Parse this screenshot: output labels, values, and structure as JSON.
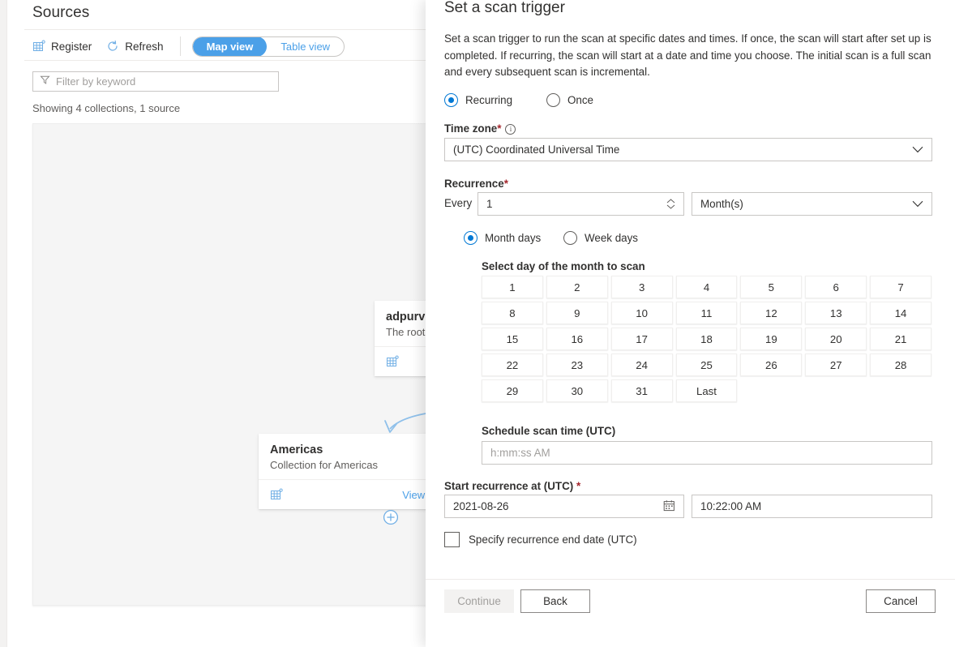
{
  "background": {
    "page_title": "Sources",
    "toolbar": {
      "register_label": "Register",
      "register_icon": "register-grid-icon",
      "refresh_label": "Refresh",
      "refresh_icon": "refresh-icon",
      "views": [
        {
          "label": "Map view",
          "active": true
        },
        {
          "label": "Table view",
          "active": false
        }
      ]
    },
    "filter": {
      "placeholder": "Filter by keyword",
      "value": "",
      "icon": "filter-funnel-icon"
    },
    "status_text": "Showing 4 collections, 1 source",
    "cards": [
      {
        "name": "adpurvi",
        "description": "The root c",
        "footer_icon": "register-grid-icon",
        "link": ""
      },
      {
        "name": "Americas",
        "description": "Collection for Americas",
        "footer_icon": "register-grid-icon",
        "link": "View d"
      }
    ],
    "add_node_icon": "plus-circle-icon"
  },
  "panel": {
    "title": "Set a scan trigger",
    "description": "Set a scan trigger to run the scan at specific dates and times. If once, the scan will start after set up is completed. If recurring, the scan will start at a date and time you choose. The initial scan is a full scan and every subsequent scan is incremental.",
    "trigger_mode": {
      "options": [
        {
          "label": "Recurring",
          "checked": true
        },
        {
          "label": "Once",
          "checked": false
        }
      ]
    },
    "timezone": {
      "label": "Time zone",
      "required": "*",
      "info_icon": "info-circle-icon",
      "value": "(UTC) Coordinated Universal Time",
      "caret_icon": "chevron-down-icon"
    },
    "recurrence": {
      "label": "Recurrence",
      "required": "*",
      "every_label": "Every",
      "interval_value": "1",
      "spinner_icon": "spinner-updown-icon",
      "unit_value": "Month(s)",
      "caret_icon": "chevron-down-icon"
    },
    "day_mode": {
      "options": [
        {
          "label": "Month days",
          "checked": true
        },
        {
          "label": "Week days",
          "checked": false
        }
      ]
    },
    "day_picker": {
      "label": "Select day of the month to scan",
      "days": [
        "1",
        "2",
        "3",
        "4",
        "5",
        "6",
        "7",
        "8",
        "9",
        "10",
        "11",
        "12",
        "13",
        "14",
        "15",
        "16",
        "17",
        "18",
        "19",
        "20",
        "21",
        "22",
        "23",
        "24",
        "25",
        "26",
        "27",
        "28",
        "29",
        "30",
        "31",
        "Last"
      ]
    },
    "schedule_scan_time": {
      "label": "Schedule scan time (UTC)",
      "placeholder": "h:mm:ss AM",
      "value": ""
    },
    "start_recurrence": {
      "label": "Start recurrence at (UTC)",
      "required": "*",
      "date_value": "2021-08-26",
      "calendar_icon": "calendar-icon",
      "time_value": "10:22:00 AM"
    },
    "end_date_checkbox": {
      "label": "Specify recurrence end date (UTC)",
      "checked": false
    },
    "footer": {
      "continue_label": "Continue",
      "continue_disabled": true,
      "back_label": "Back",
      "cancel_label": "Cancel"
    }
  },
  "colors": {
    "accent": "#0078d4",
    "link": "#4ba0e8",
    "required": "#a4262c",
    "canvas": "#f5f5f5"
  }
}
